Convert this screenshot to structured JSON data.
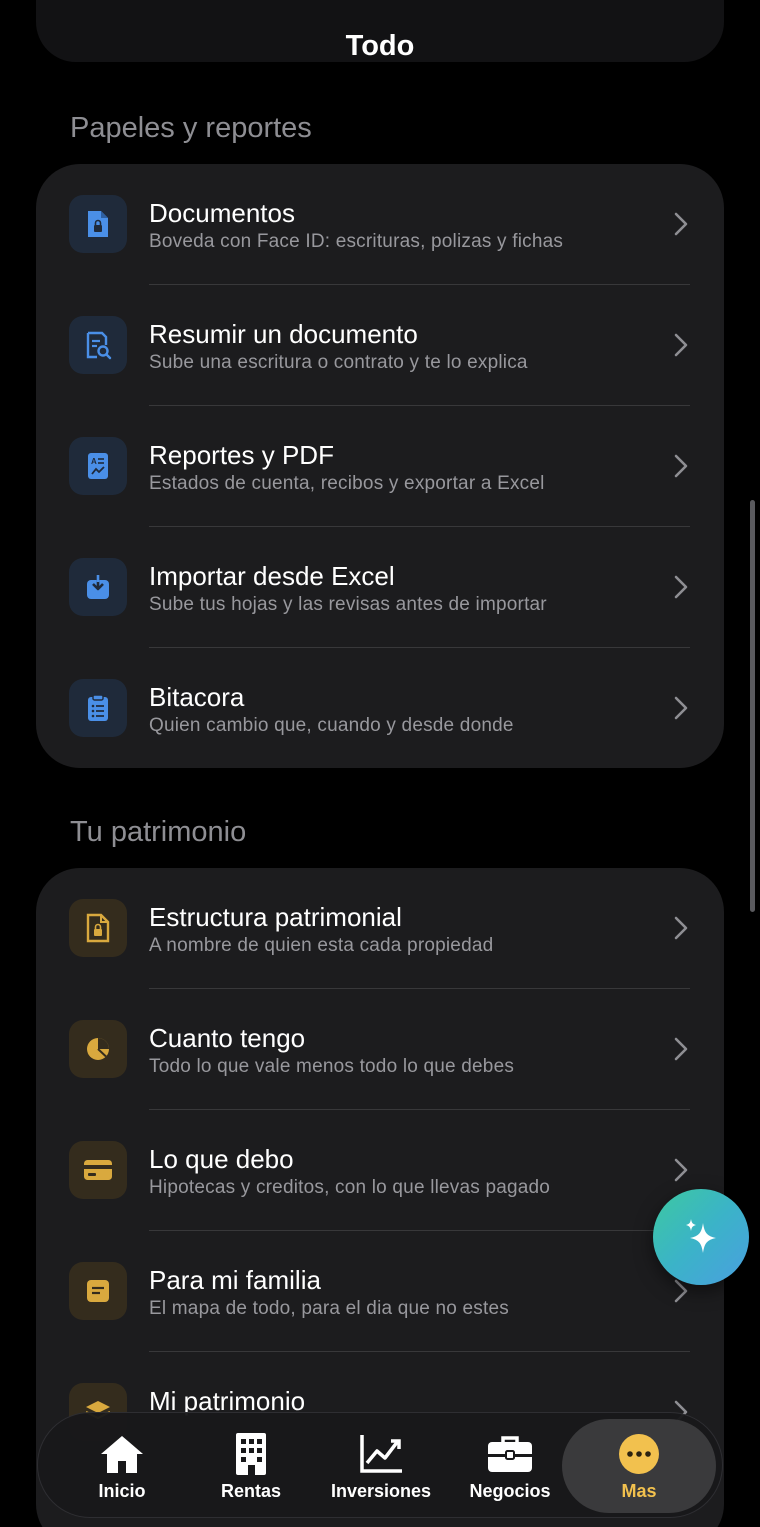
{
  "header": {
    "title": "Todo"
  },
  "sections": [
    {
      "title": "Papeles y reportes",
      "items": [
        {
          "icon": "document-lock-icon",
          "title": "Documentos",
          "subtitle": "Boveda con Face ID: escrituras, polizas y fichas"
        },
        {
          "icon": "document-search-icon",
          "title": "Resumir un documento",
          "subtitle": "Sube una escritura o contrato y te lo explica"
        },
        {
          "icon": "report-icon",
          "title": "Reportes y PDF",
          "subtitle": "Estados de cuenta, recibos y exportar a Excel"
        },
        {
          "icon": "import-download-icon",
          "title": "Importar desde Excel",
          "subtitle": "Sube tus hojas y las revisas antes de importar"
        },
        {
          "icon": "clipboard-icon",
          "title": "Bitacora",
          "subtitle": "Quien cambio que, cuando y desde donde"
        }
      ]
    },
    {
      "title": "Tu patrimonio",
      "items": [
        {
          "icon": "document-lock-icon",
          "title": "Estructura patrimonial",
          "subtitle": "A nombre de quien esta cada propiedad"
        },
        {
          "icon": "pie-chart-icon",
          "title": "Cuanto tengo",
          "subtitle": "Todo lo que vale menos todo lo que debes"
        },
        {
          "icon": "credit-card-icon",
          "title": "Lo que debo",
          "subtitle": "Hipotecas y creditos, con lo que llevas pagado"
        },
        {
          "icon": "family-note-icon",
          "title": "Para mi familia",
          "subtitle": "El mapa de todo, para el dia que no estes"
        },
        {
          "icon": "layers-icon",
          "title": "Mi patrimonio",
          "subtitle": ""
        }
      ]
    }
  ],
  "tabbar": {
    "tabs": [
      {
        "label": "Inicio",
        "icon": "home-icon"
      },
      {
        "label": "Rentas",
        "icon": "building-icon"
      },
      {
        "label": "Inversiones",
        "icon": "chart-line-icon"
      },
      {
        "label": "Negocios",
        "icon": "briefcase-icon"
      },
      {
        "label": "Mas",
        "icon": "more-dots-icon"
      }
    ],
    "active": "Mas"
  },
  "colors": {
    "accent_blue": "#4a8fe7",
    "accent_gold": "#d9a93e",
    "active_tab": "#f2c14e"
  }
}
